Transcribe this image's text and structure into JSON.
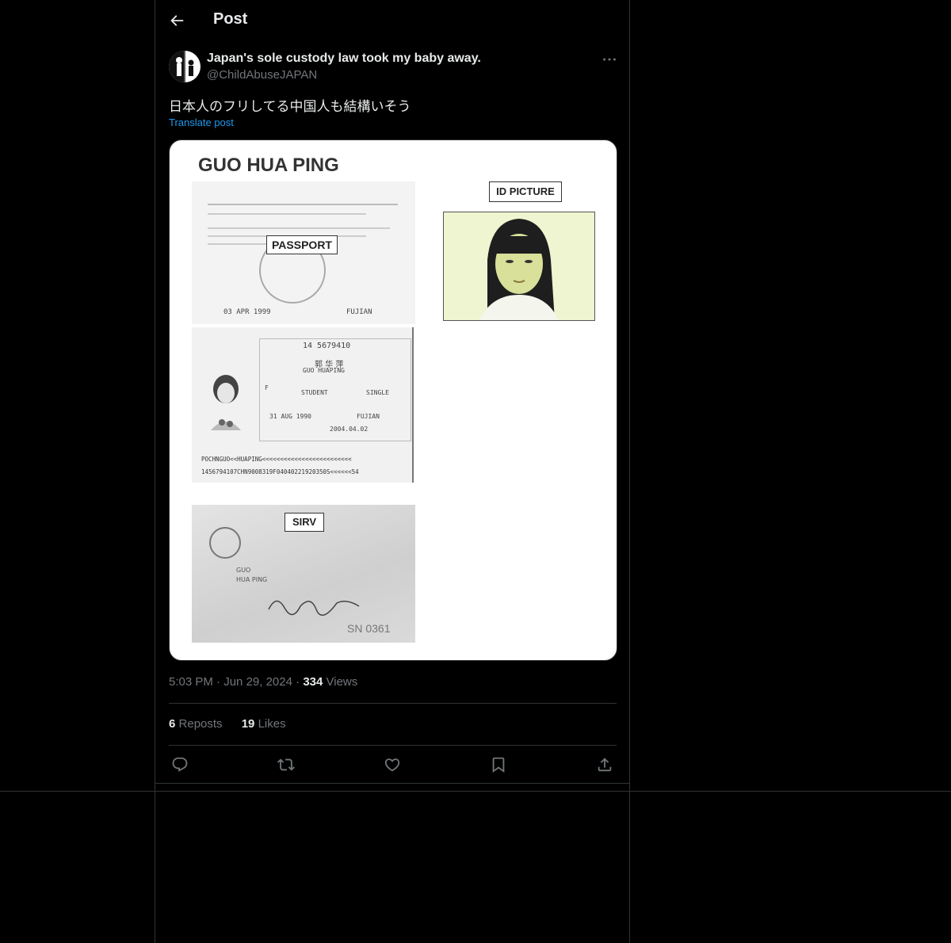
{
  "header": {
    "title": "Post"
  },
  "author": {
    "display_name": "Japan's sole custody law took my baby away.",
    "handle": "@ChildAbuseJAPAN"
  },
  "post": {
    "text": "日本人のフリしてる中国人も結構いそう",
    "translate_label": "Translate post",
    "time": "5:03 PM",
    "date": "Jun 29, 2024",
    "views_count": "334",
    "views_label": "Views",
    "reposts_count": "6",
    "reposts_label": "Reposts",
    "likes_count": "19",
    "likes_label": "Likes"
  },
  "media": {
    "name_heading": "GUO HUA PING",
    "passport_label": "PASSPORT",
    "id_picture_label": "ID PICTURE",
    "sirv_label": "SIRV",
    "passport_no": "14 5679410",
    "name_cn": "郭 华 萍",
    "name_en": "GUO HUAPING",
    "occupation": "STUDENT",
    "status": "SINGLE",
    "dob": "31 AUG 1990",
    "place": "FUJIAN",
    "expiry": "2004.04.02",
    "issue_date": "03 APR 1999",
    "mrz1": "POCHNGUO<<HUAPING<<<<<<<<<<<<<<<<<<<<<<<<<",
    "mrz2": "1456794107CHN9008319F04040221920350S<<<<<<54",
    "sirv_surname": "GUO",
    "sirv_given": "HUA PING",
    "sirv_no": "SN 0361",
    "sex": "F"
  },
  "icons": [
    "back-arrow-icon",
    "more-icon",
    "reply-icon",
    "repost-icon",
    "like-icon",
    "bookmark-icon",
    "share-icon"
  ]
}
